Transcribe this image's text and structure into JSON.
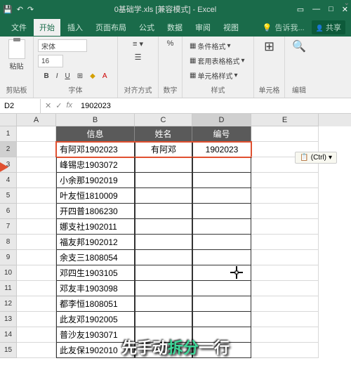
{
  "titlebar": {
    "filename": "0基础学.xls [兼容模式] - Excel"
  },
  "menu": {
    "tabs": [
      "文件",
      "开始",
      "插入",
      "页面布局",
      "公式",
      "数据",
      "审阅",
      "视图"
    ],
    "active": 1,
    "tell": "告诉我...",
    "share": "共享"
  },
  "ribbon": {
    "clipboard": {
      "paste": "粘贴",
      "label": "剪贴板"
    },
    "font": {
      "name": "宋体",
      "size": "16",
      "label": "字体"
    },
    "align": {
      "label": "对齐方式"
    },
    "number": {
      "label": "数字"
    },
    "styles": {
      "cond": "条件格式",
      "table": "套用表格格式",
      "cell": "单元格样式",
      "label": "样式"
    },
    "cells": {
      "label": "单元格"
    },
    "edit": {
      "label": "编辑"
    }
  },
  "namebox": "D2",
  "formula": "1902023",
  "cols": [
    "A",
    "B",
    "C",
    "D",
    "E"
  ],
  "headers": {
    "b": "信息",
    "c": "姓名",
    "d": "编号"
  },
  "rows": [
    {
      "n": 1
    },
    {
      "n": 2,
      "b": "有阿邓1902023",
      "c": "有阿邓",
      "d": "1902023"
    },
    {
      "n": 3,
      "b": "峰锡忠1903072"
    },
    {
      "n": 4,
      "b": "小余那1902019"
    },
    {
      "n": 5,
      "b": "叶友恒1810009"
    },
    {
      "n": 6,
      "b": "开四普1806230"
    },
    {
      "n": 7,
      "b": "娜支社1902011"
    },
    {
      "n": 8,
      "b": "福友邦1902012"
    },
    {
      "n": 9,
      "b": "余支三1808054"
    },
    {
      "n": 10,
      "b": "邓四生1903105"
    },
    {
      "n": 11,
      "b": "邓友丰1903098"
    },
    {
      "n": 12,
      "b": "都李恒1808051"
    },
    {
      "n": 13,
      "b": "此友邓1902005"
    },
    {
      "n": 14,
      "b": "普沙友1903071"
    },
    {
      "n": 15,
      "b": "此友保1902010"
    }
  ],
  "ctrlhint": "(Ctrl)",
  "subtitle": {
    "p1": "先手动",
    "hl": "拆分",
    "p2": "一行"
  }
}
